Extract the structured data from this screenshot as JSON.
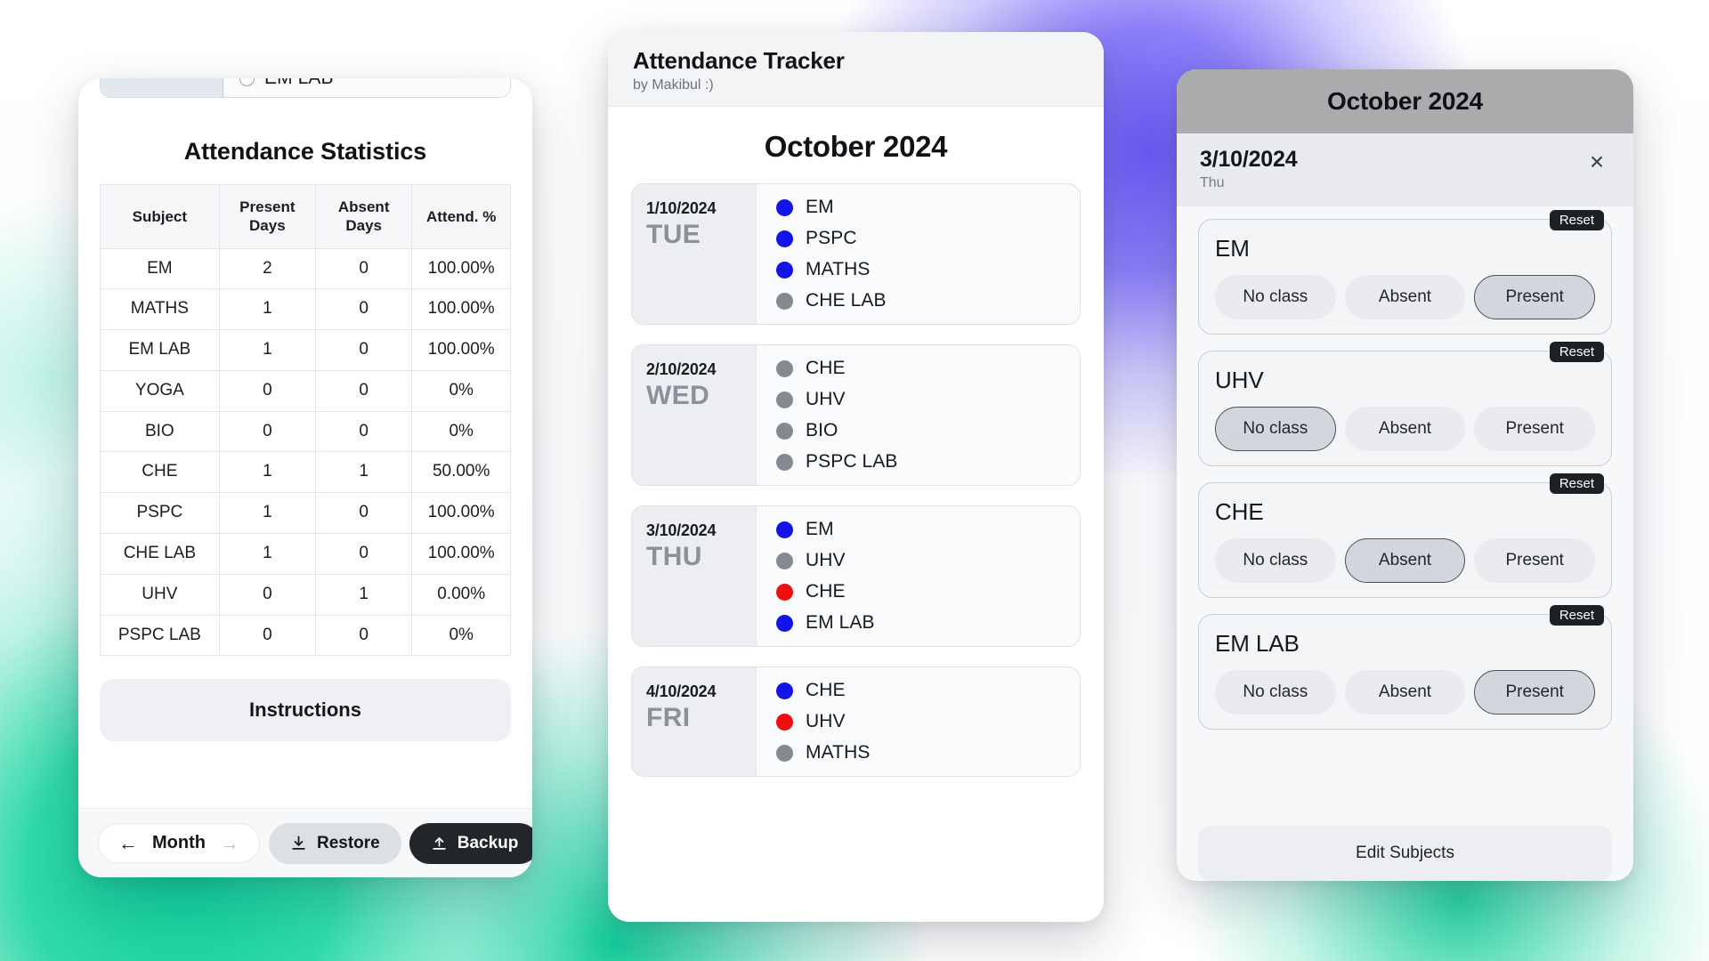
{
  "left_panel": {
    "subject_picker": {
      "radio_label": "EM LAB"
    },
    "stats_title": "Attendance Statistics",
    "table": {
      "headers": [
        "Subject",
        "Present Days",
        "Absent Days",
        "Attend. %"
      ],
      "rows": [
        {
          "subject": "EM",
          "present": "2",
          "absent": "0",
          "percent": "100.00%"
        },
        {
          "subject": "MATHS",
          "present": "1",
          "absent": "0",
          "percent": "100.00%"
        },
        {
          "subject": "EM LAB",
          "present": "1",
          "absent": "0",
          "percent": "100.00%"
        },
        {
          "subject": "YOGA",
          "present": "0",
          "absent": "0",
          "percent": "0%"
        },
        {
          "subject": "BIO",
          "present": "0",
          "absent": "0",
          "percent": "0%"
        },
        {
          "subject": "CHE",
          "present": "1",
          "absent": "1",
          "percent": "50.00%"
        },
        {
          "subject": "PSPC",
          "present": "1",
          "absent": "0",
          "percent": "100.00%"
        },
        {
          "subject": "CHE LAB",
          "present": "1",
          "absent": "0",
          "percent": "100.00%"
        },
        {
          "subject": "UHV",
          "present": "0",
          "absent": "1",
          "percent": "0.00%"
        },
        {
          "subject": "PSPC LAB",
          "present": "0",
          "absent": "0",
          "percent": "0%"
        }
      ]
    },
    "instructions_label": "Instructions",
    "footer": {
      "month_label": "Month",
      "prev_arrow": "←",
      "next_arrow": "→",
      "restore_label": "Restore",
      "backup_label": "Backup"
    }
  },
  "middle_panel": {
    "app_title": "Attendance Tracker",
    "app_subtitle": "by Makibul :)",
    "month_title": "October 2024",
    "days": [
      {
        "date": "1/10/2024",
        "dow": "TUE",
        "subjects": [
          {
            "name": "EM",
            "status_color": "#1414e6"
          },
          {
            "name": "PSPC",
            "status_color": "#1414e6"
          },
          {
            "name": "MATHS",
            "status_color": "#1414e6"
          },
          {
            "name": "CHE LAB",
            "status_color": "#858a90"
          }
        ]
      },
      {
        "date": "2/10/2024",
        "dow": "WED",
        "subjects": [
          {
            "name": "CHE",
            "status_color": "#858a90"
          },
          {
            "name": "UHV",
            "status_color": "#858a90"
          },
          {
            "name": "BIO",
            "status_color": "#858a90"
          },
          {
            "name": "PSPC LAB",
            "status_color": "#858a90"
          }
        ]
      },
      {
        "date": "3/10/2024",
        "dow": "THU",
        "subjects": [
          {
            "name": "EM",
            "status_color": "#1414e6"
          },
          {
            "name": "UHV",
            "status_color": "#858a90"
          },
          {
            "name": "CHE",
            "status_color": "#ef0f0f"
          },
          {
            "name": "EM LAB",
            "status_color": "#1414e6"
          }
        ]
      },
      {
        "date": "4/10/2024",
        "dow": "FRI",
        "subjects": [
          {
            "name": "CHE",
            "status_color": "#1414e6"
          },
          {
            "name": "UHV",
            "status_color": "#ef0f0f"
          },
          {
            "name": "MATHS",
            "status_color": "#858a90"
          }
        ]
      }
    ]
  },
  "right_panel": {
    "month_title": "October 2024",
    "selected_date": "3/10/2024",
    "selected_dow": "Thu",
    "close_icon": "×",
    "reset_label": "Reset",
    "options": [
      "No class",
      "Absent",
      "Present"
    ],
    "subjects": [
      {
        "name": "EM",
        "selected": "Present"
      },
      {
        "name": "UHV",
        "selected": "No class"
      },
      {
        "name": "CHE",
        "selected": "Absent"
      },
      {
        "name": "EM LAB",
        "selected": "Present"
      }
    ],
    "edit_subjects_label": "Edit Subjects"
  }
}
